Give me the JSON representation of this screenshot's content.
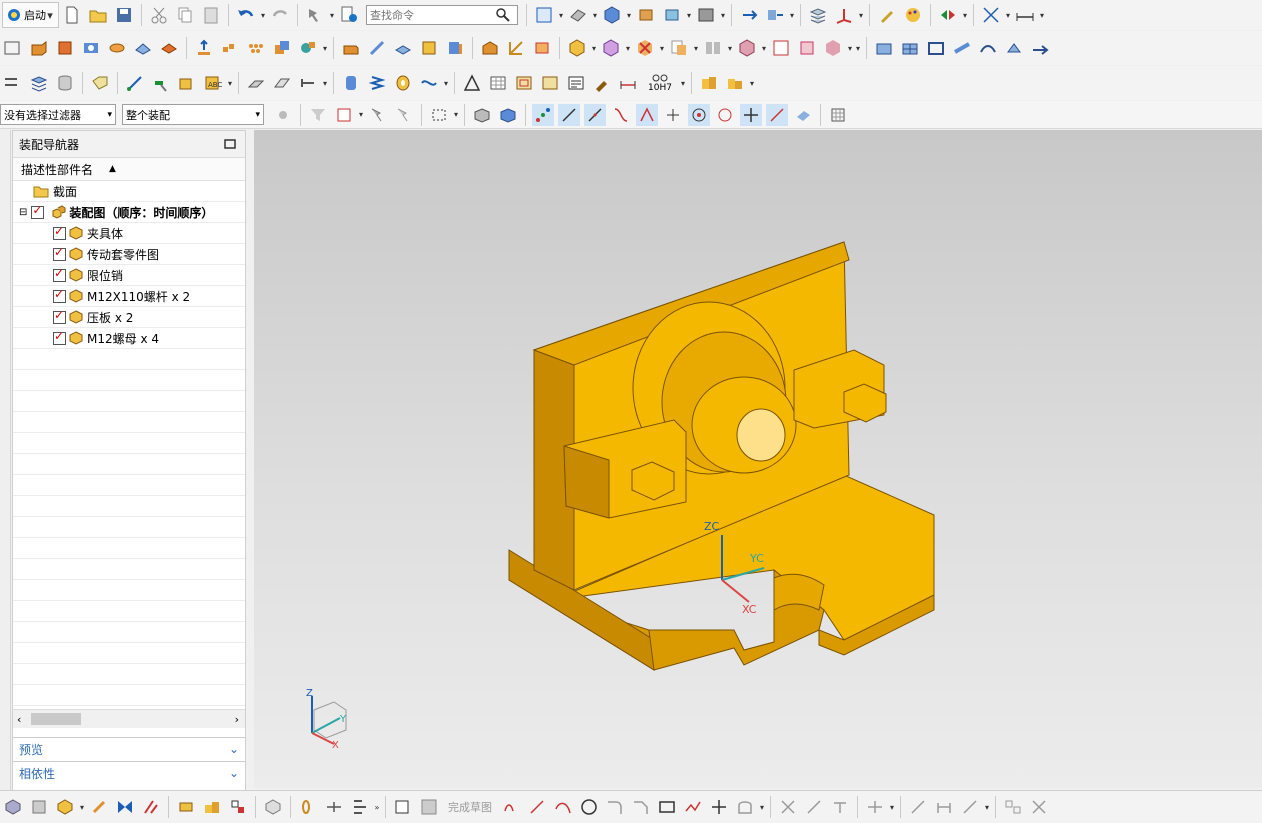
{
  "toolbar": {
    "start_label": "启动",
    "search_placeholder": "查找命令",
    "filter_select": "没有选择过滤器",
    "assembly_select": "整个装配",
    "tolerance_label": "10H7"
  },
  "navigator": {
    "title": "装配导航器",
    "column_header": "描述性部件名",
    "section_item": "截面",
    "root_item": "装配图（顺序：时间顺序）",
    "children": [
      "夹具体",
      "传动套零件图",
      "限位销",
      "M12X110螺杆 x 2",
      "压板 x 2",
      "M12螺母 x 4"
    ],
    "preview_label": "预览",
    "dependency_label": "相依性"
  },
  "viewport": {
    "axis_zc": "ZC",
    "axis_yc": "YC",
    "axis_xc": "XC",
    "triad_z": "Z",
    "triad_y": "Y",
    "triad_x": "X",
    "part_color": "#F5B800",
    "part_shadow_color": "#C88A00",
    "background_top": "#C8C8C8",
    "background_bottom": "#ECECEC"
  },
  "bottom_toolbar": {
    "finish_sketch_label": "完成草图"
  }
}
